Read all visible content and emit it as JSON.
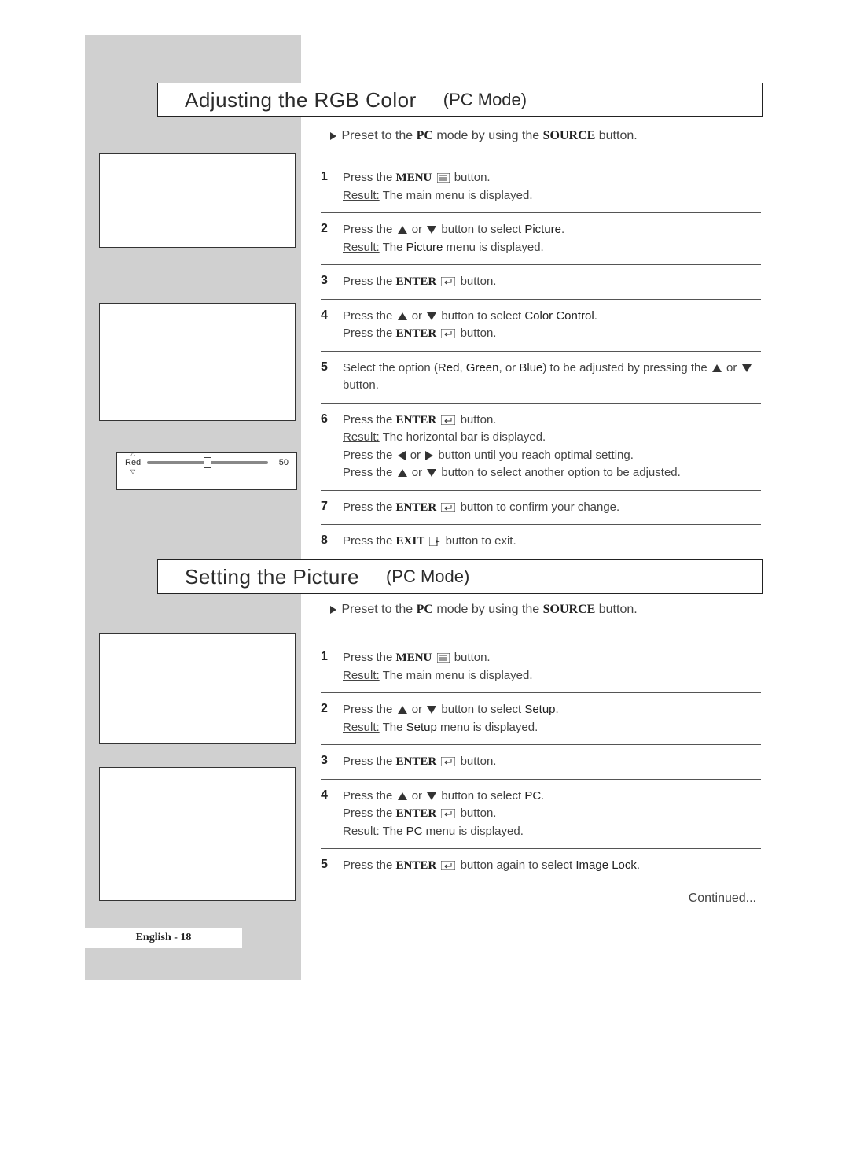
{
  "section1": {
    "titleMain": "Adjusting the RGB Color",
    "titleMode": "(PC Mode)",
    "leadPrefix": "Preset to the",
    "leadPC": "PC",
    "leadMid": "mode by using the",
    "leadSource": "SOURCE",
    "leadSuffix": "button.",
    "steps": {
      "s1a": "Press the",
      "s1b": "MENU",
      "s1c": "button.",
      "s1d": "Result:",
      "s1e": "The main menu is displayed.",
      "s2a": "Press the",
      "s2b": "or",
      "s2c": "button to select",
      "s2d": "Picture",
      "s2e": ".",
      "s2f": "Result:",
      "s2g": "The",
      "s2h": "Picture",
      "s2i": "menu is displayed.",
      "s3a": "Press the",
      "s3b": "ENTER",
      "s3c": "button.",
      "s4a": "Press the",
      "s4b": "or",
      "s4c": "button to select",
      "s4d": "Color Control",
      "s4e": ".",
      "s4f": "Press the",
      "s4g": "ENTER",
      "s4h": "button.",
      "s5a": "Select the option (",
      "s5b": "Red",
      "s5c": ",",
      "s5d": "Green",
      "s5e": ", or",
      "s5f": "Blue",
      "s5g": ") to be adjusted by pressing the",
      "s5h": "or",
      "s5i": "button.",
      "s6a": "Press the",
      "s6b": "ENTER",
      "s6c": "button.",
      "s6d": "Result:",
      "s6e": "The horizontal bar is displayed.",
      "s6f": "Press the",
      "s6g": "or",
      "s6h": "button until you reach optimal setting.",
      "s6i": "Press the",
      "s6j": "or",
      "s6k": "button to select another option to be adjusted.",
      "s7a": "Press the",
      "s7b": "ENTER",
      "s7c": "button to confirm your change.",
      "s8a": "Press the",
      "s8b": "EXIT",
      "s8c": "button to exit."
    }
  },
  "slider": {
    "label": "Red",
    "value": "50"
  },
  "section2": {
    "titleMain": "Setting the Picture",
    "titleMode": "(PC Mode)",
    "leadPrefix": "Preset to the",
    "leadPC": "PC",
    "leadMid": "mode by using the",
    "leadSource": "SOURCE",
    "leadSuffix": "button.",
    "steps": {
      "s1a": "Press the",
      "s1b": "MENU",
      "s1c": "button.",
      "s1d": "Result:",
      "s1e": "The main menu is displayed.",
      "s2a": "Press the",
      "s2b": "or",
      "s2c": "button to select",
      "s2d": "Setup",
      "s2e": ".",
      "s2f": "Result:",
      "s2g": "The",
      "s2h": "Setup",
      "s2i": "menu is displayed.",
      "s3a": "Press the",
      "s3b": "ENTER",
      "s3c": "button.",
      "s4a": "Press the",
      "s4b": "or",
      "s4c": "button to select",
      "s4d": "PC",
      "s4e": ".",
      "s4f": "Press the",
      "s4g": "ENTER",
      "s4h": "button.",
      "s4i": "Result:",
      "s4j": "The",
      "s4k": "PC",
      "s4l": "menu is displayed.",
      "s5a": "Press the",
      "s5b": "ENTER",
      "s5c": "button again to select",
      "s5d": "Image Lock",
      "s5e": ".",
      "cont": "Continued..."
    }
  },
  "footer": "English - 18"
}
